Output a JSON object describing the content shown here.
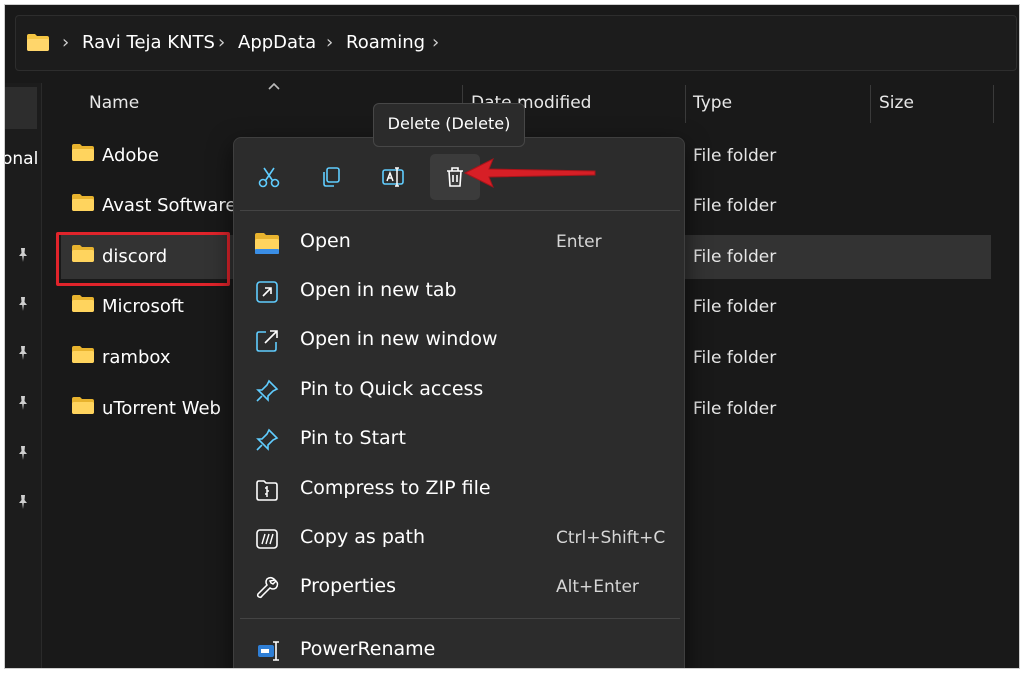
{
  "address_bar": {
    "crumbs": [
      "Ravi Teja KNTS",
      "AppData",
      "Roaming"
    ]
  },
  "sidebar": {
    "partial_label": "onal"
  },
  "columns": {
    "name": "Name",
    "date_modified": "Date modified",
    "type": "Type",
    "size": "Size"
  },
  "files": [
    {
      "name": "Adobe",
      "type": "File folder"
    },
    {
      "name": "Avast Software",
      "type": "File folder"
    },
    {
      "name": "discord",
      "type": "File folder"
    },
    {
      "name": "Microsoft",
      "type": "File folder"
    },
    {
      "name": "rambox",
      "type": "File folder"
    },
    {
      "name": "uTorrent Web",
      "type": "File folder"
    }
  ],
  "tooltip": "Delete (Delete)",
  "context_menu": {
    "toolbar": [
      "cut-icon",
      "copy-icon",
      "rename-icon",
      "delete-icon"
    ],
    "items": [
      {
        "label": "Open",
        "shortcut": "Enter",
        "icon": "folder-icon"
      },
      {
        "label": "Open in new tab",
        "shortcut": "",
        "icon": "new-tab-icon"
      },
      {
        "label": "Open in new window",
        "shortcut": "",
        "icon": "new-window-icon"
      },
      {
        "label": "Pin to Quick access",
        "shortcut": "",
        "icon": "pin-icon"
      },
      {
        "label": "Pin to Start",
        "shortcut": "",
        "icon": "pin-icon"
      },
      {
        "label": "Compress to ZIP file",
        "shortcut": "",
        "icon": "zip-icon"
      },
      {
        "label": "Copy as path",
        "shortcut": "Ctrl+Shift+C",
        "icon": "copy-path-icon"
      },
      {
        "label": "Properties",
        "shortcut": "Alt+Enter",
        "icon": "wrench-icon"
      },
      {
        "label": "PowerRename",
        "shortcut": "",
        "icon": "powerrename-icon"
      }
    ]
  },
  "colors": {
    "background": "#191919",
    "menu_bg": "#2c2c2c",
    "accent": "#60cdff",
    "highlight_red": "#e0242b",
    "folder_yellow": "#f4c542"
  }
}
